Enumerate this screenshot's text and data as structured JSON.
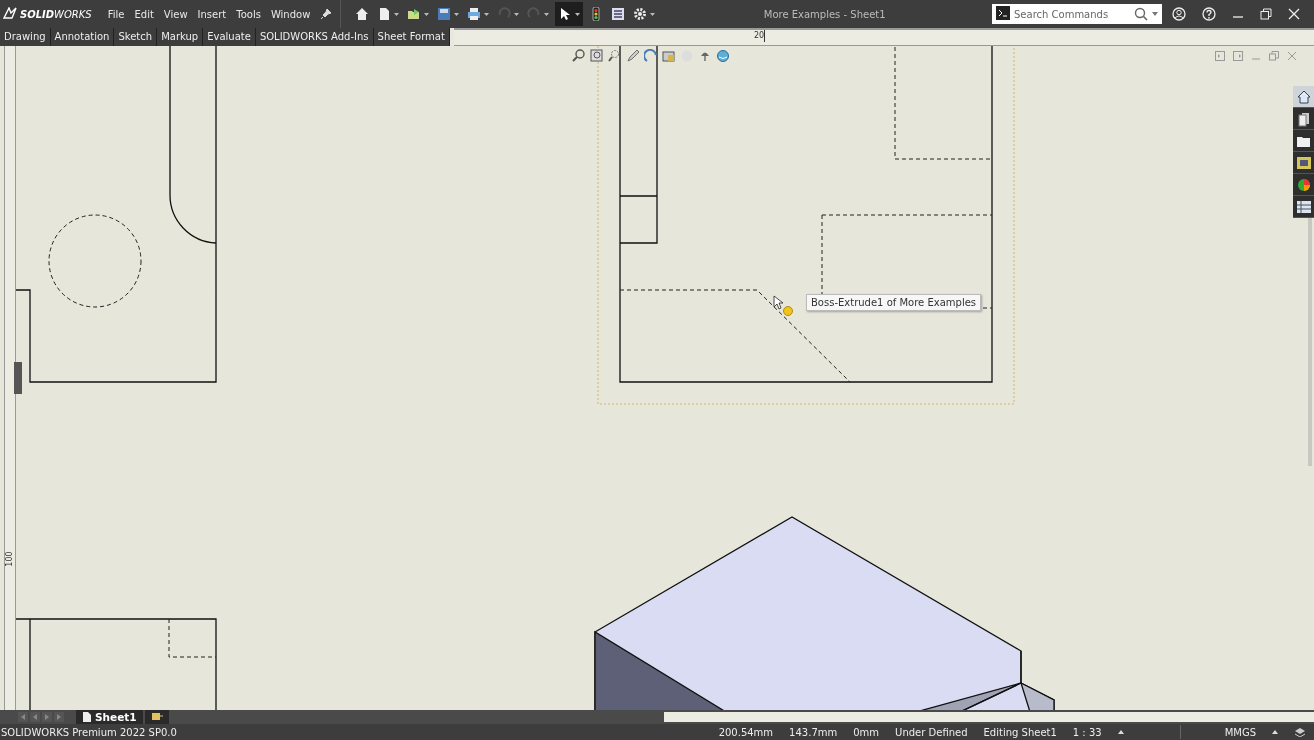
{
  "app": {
    "logo": "**SOLID**WORKS"
  },
  "menu": [
    "File",
    "Edit",
    "View",
    "Insert",
    "Tools",
    "Window"
  ],
  "window": {
    "title": "More Examples - Sheet1"
  },
  "search": {
    "placeholder": "Search Commands"
  },
  "tabs": [
    "Drawing",
    "Annotation",
    "Sketch",
    "Markup",
    "Evaluate",
    "SOLIDWORKS Add-Ins",
    "Sheet Format"
  ],
  "rulers": {
    "horizontal_label": "20",
    "vertical_label": "100"
  },
  "tooltip": {
    "text": "Boss-Extrude1 of More Examples"
  },
  "sheet_tabs": [
    {
      "label": "Sheet1"
    }
  ],
  "status_bar": {
    "product": "SOLIDWORKS Premium 2022 SP0.0",
    "x": "200.54mm",
    "y": "143.7mm",
    "z": "0mm",
    "sketch_state": "Under Defined",
    "editing": "Editing Sheet1",
    "scale": "1 : 33",
    "units": "MMGS"
  }
}
